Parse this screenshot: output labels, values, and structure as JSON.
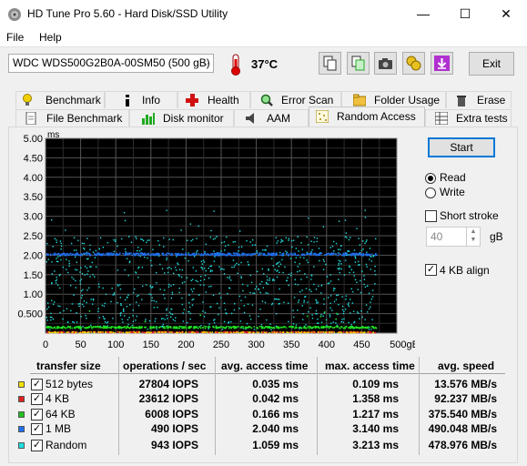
{
  "window": {
    "title": "HD Tune Pro 5.60 - Hard Disk/SSD Utility",
    "minimize": "—",
    "maximize": "☐",
    "close": "✕"
  },
  "menu": [
    {
      "label": "File"
    },
    {
      "label": "Help"
    }
  ],
  "toolbar": {
    "drive": "WDC WDS500G2B0A-00SM50 (500 gB)",
    "temperature": "37°C",
    "exit_label": "Exit"
  },
  "tabs_row1": [
    {
      "label": "Benchmark"
    },
    {
      "label": "Info"
    },
    {
      "label": "Health"
    },
    {
      "label": "Error Scan"
    },
    {
      "label": "Folder Usage"
    },
    {
      "label": "Erase"
    }
  ],
  "tabs_row2": [
    {
      "label": "File Benchmark"
    },
    {
      "label": "Disk monitor"
    },
    {
      "label": "AAM"
    },
    {
      "label": "Random Access"
    },
    {
      "label": "Extra tests"
    }
  ],
  "controls": {
    "start_label": "Start",
    "read_label": "Read",
    "write_label": "Write",
    "mode_selected": "Read",
    "short_stroke_label": "Short stroke",
    "short_stroke_checked": false,
    "short_stroke_value": "40",
    "short_stroke_unit": "gB",
    "align_label": "4 KB align",
    "align_checked": true
  },
  "chart_data": {
    "type": "scatter",
    "ylabel": "ms",
    "xlabel": "gB",
    "xlim": [
      0,
      500
    ],
    "ylim": [
      0,
      5
    ],
    "y_ticks": [
      "5.00",
      "4.50",
      "4.00",
      "3.50",
      "3.00",
      "2.50",
      "2.00",
      "1.50",
      "1.00",
      "0.500"
    ],
    "x_ticks": [
      "0",
      "50",
      "100",
      "150",
      "200",
      "250",
      "300",
      "350",
      "400",
      "450",
      "500gB"
    ],
    "grid": true,
    "series": [
      {
        "name": "512 bytes",
        "color": "#f5e000",
        "mean_ms": 0.035,
        "max_ms": 0.109
      },
      {
        "name": "4 KB",
        "color": "#e02020",
        "mean_ms": 0.042,
        "max_ms": 1.358
      },
      {
        "name": "64 KB",
        "color": "#22e022",
        "mean_ms": 0.166,
        "max_ms": 1.217
      },
      {
        "name": "1 MB",
        "color": "#2070f0",
        "mean_ms": 2.04,
        "max_ms": 3.14
      },
      {
        "name": "Random",
        "color": "#20e0e0",
        "mean_ms": 1.059,
        "max_ms": 3.213
      }
    ]
  },
  "results": {
    "headers": [
      "transfer size",
      "operations / sec",
      "avg. access time",
      "max. access time",
      "avg. speed"
    ],
    "rows": [
      {
        "size": "512 bytes",
        "ops": "27804 IOPS",
        "avg": "0.035 ms",
        "max": "0.109 ms",
        "speed": "13.576 MB/s",
        "color": "#f5e000",
        "checked": true
      },
      {
        "size": "4 KB",
        "ops": "23612 IOPS",
        "avg": "0.042 ms",
        "max": "1.358 ms",
        "speed": "92.237 MB/s",
        "color": "#e02020",
        "checked": true
      },
      {
        "size": "64 KB",
        "ops": "6008 IOPS",
        "avg": "0.166 ms",
        "max": "1.217 ms",
        "speed": "375.540 MB/s",
        "color": "#22c022",
        "checked": true
      },
      {
        "size": "1 MB",
        "ops": "490 IOPS",
        "avg": "2.040 ms",
        "max": "3.140 ms",
        "speed": "490.048 MB/s",
        "color": "#2070f0",
        "checked": true
      },
      {
        "size": "Random",
        "ops": "943 IOPS",
        "avg": "1.059 ms",
        "max": "3.213 ms",
        "speed": "478.976 MB/s",
        "color": "#20e0e0",
        "checked": true
      }
    ]
  }
}
